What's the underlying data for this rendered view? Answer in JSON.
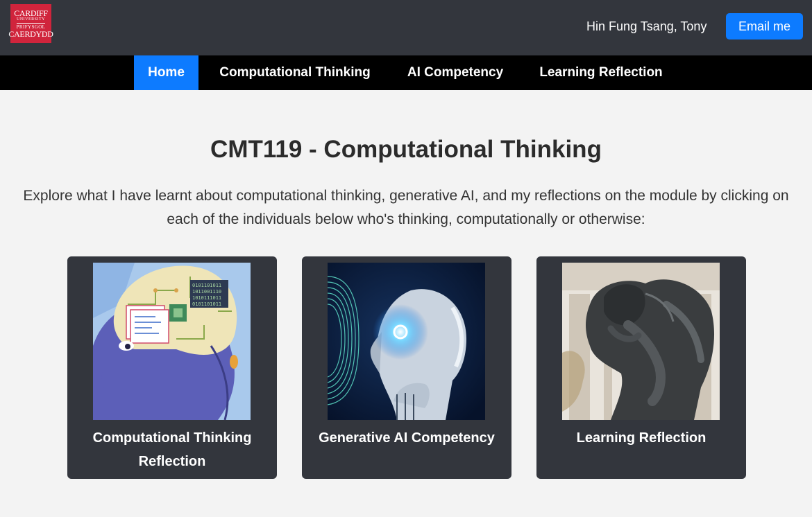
{
  "header": {
    "logo": {
      "line1": "CARDIFF",
      "line2": "UNIVERSITY",
      "line3": "PRIFYSGOL",
      "line4": "CAERDYDD"
    },
    "user_name": "Hin Fung Tsang, Tony",
    "email_button": "Email me"
  },
  "nav": {
    "items": [
      {
        "label": "Home",
        "active": true
      },
      {
        "label": "Computational Thinking",
        "active": false
      },
      {
        "label": "AI Competency",
        "active": false
      },
      {
        "label": "Learning Reflection",
        "active": false
      }
    ]
  },
  "main": {
    "title": "CMT119 - Computational Thinking",
    "intro": "Explore what I have learnt about computational thinking, generative AI, and my reflections on the module by clicking on each of the individuals below who's thinking, computationally or otherwise:",
    "cards": [
      {
        "label": "Computational Thinking Reflection",
        "image": "cartoon-girl-brain-circuit-image"
      },
      {
        "label": "Generative AI Competency",
        "image": "robot-thinking-image"
      },
      {
        "label": "Learning Reflection",
        "image": "the-thinker-statue-image"
      }
    ]
  },
  "colors": {
    "topbar": "#33363d",
    "navbar": "#000000",
    "accent": "#0d7bff",
    "logo": "#d0243c",
    "page_bg": "#f3f3f3",
    "card_bg": "#33363d"
  }
}
